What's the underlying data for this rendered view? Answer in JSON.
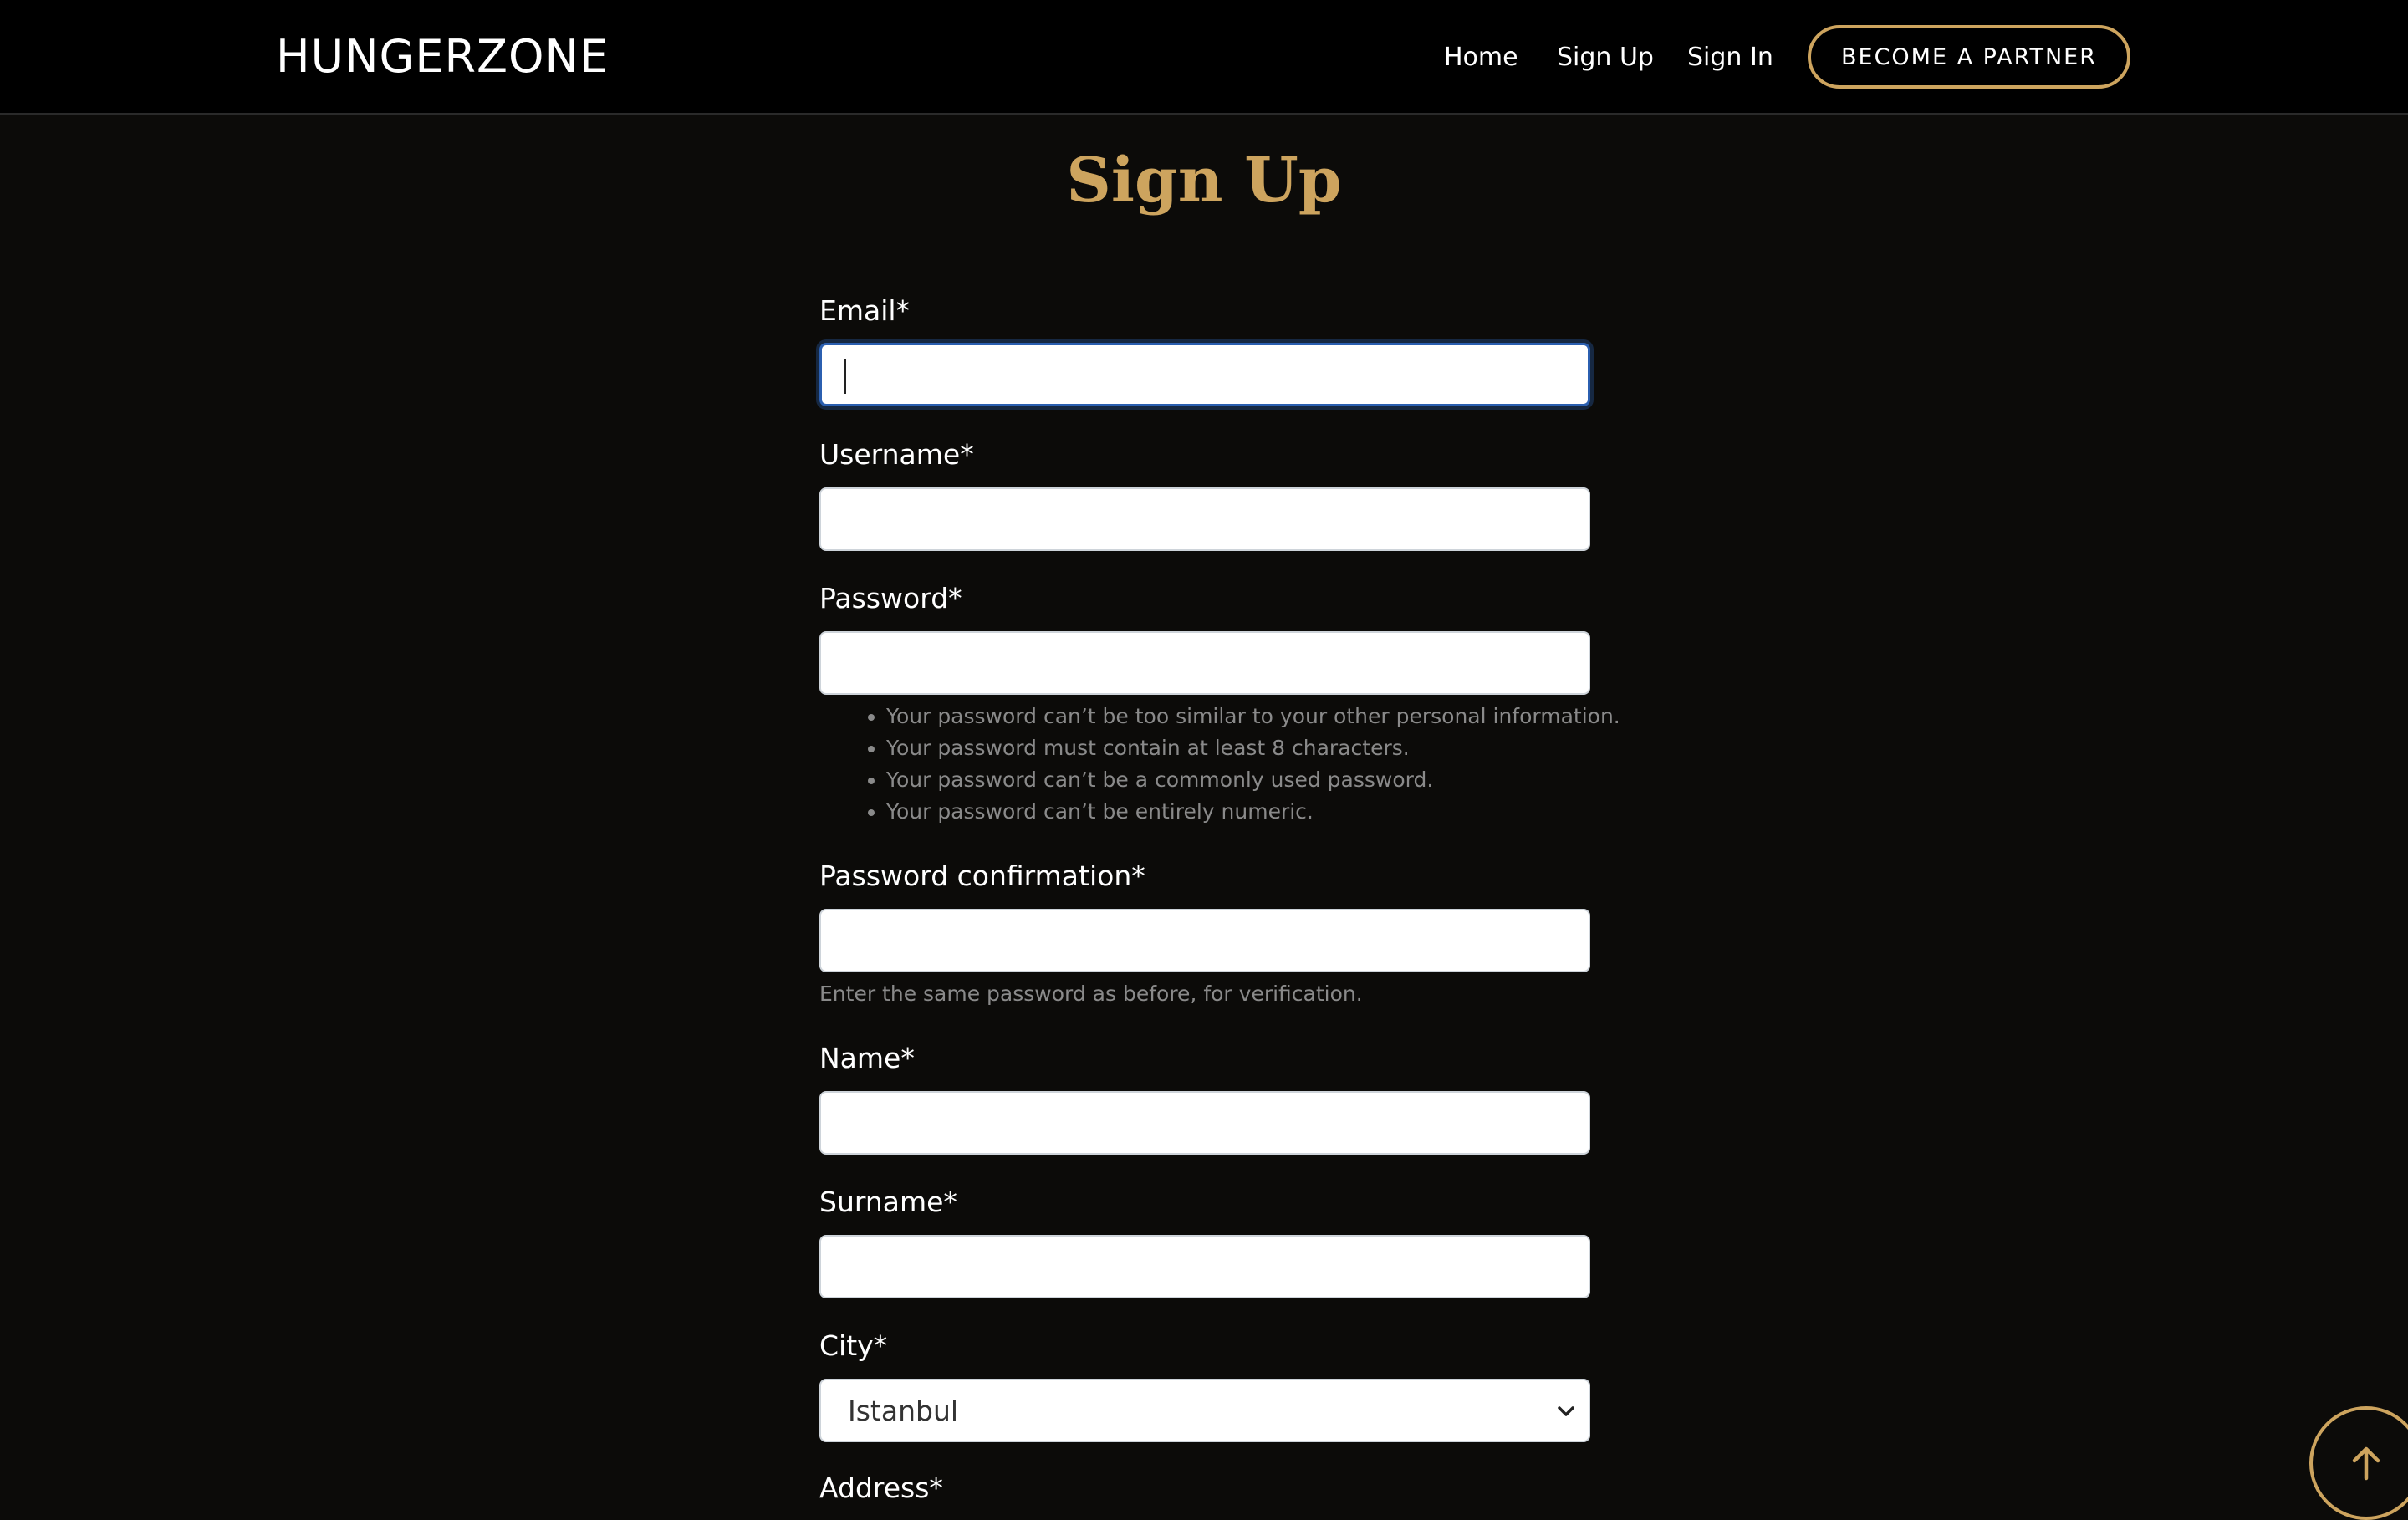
{
  "colors": {
    "background": "#0c0b09",
    "navbar": "#000000",
    "accent": "#cda45e",
    "focus": "#2b5fb0",
    "help_text": "#8a8a8a"
  },
  "navbar": {
    "logo": "HUNGERZONE",
    "links": [
      "Home",
      "Sign Up",
      "Sign In"
    ],
    "partner_button": "BECOME A PARTNER"
  },
  "page_title": "Sign Up",
  "form": {
    "email": {
      "label": "Email*",
      "value": ""
    },
    "username": {
      "label": "Username*",
      "value": ""
    },
    "password": {
      "label": "Password*",
      "value": "",
      "help": [
        "Your password can’t be too similar to your other personal information.",
        "Your password must contain at least 8 characters.",
        "Your password can’t be a commonly used password.",
        "Your password can’t be entirely numeric."
      ]
    },
    "password_confirmation": {
      "label": "Password confirmation*",
      "value": "",
      "help": "Enter the same password as before, for verification."
    },
    "name": {
      "label": "Name*",
      "value": ""
    },
    "surname": {
      "label": "Surname*",
      "value": ""
    },
    "city": {
      "label": "City*",
      "selected": "Istanbul"
    },
    "address": {
      "label": "Address*"
    }
  },
  "icons": {
    "scroll_top": "arrow-up-icon",
    "select": "chevron-down-icon"
  }
}
